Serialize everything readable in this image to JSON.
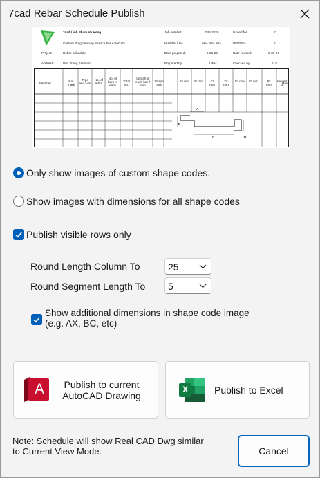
{
  "window": {
    "title": "7cad Rebar Schedule Publish"
  },
  "preview": {
    "company": "7cad Linh Pham Vu Hong",
    "service": "Custom Programming Service For AutoCAD",
    "project_label": "Project:",
    "project_value": "Rebar Schedule",
    "address_label": "Address:",
    "address_value": "Nha Trang, Vietnam",
    "job_number_label": "Job number:",
    "job_number_value": "045-2020",
    "issued_for_label": "Issued for:",
    "issued_for_value": "C",
    "drawing_info_label": "Drawing info:",
    "drawing_info_value": "510, 520, 521",
    "revision_label": "Revision:",
    "revision_value": "A",
    "date_prepared_label": "Date prepared:",
    "date_prepared_value": "9-26-24",
    "date_revised_label": "Date revised:",
    "date_revised_value": "8-30-24",
    "prepared_by_label": "Prepared by:",
    "prepared_by_value": "LINH",
    "checked_by_label": "Checked by:",
    "checked_by_value": "V.S",
    "columns": [
      "Member",
      "Bar mark",
      "Type and size",
      "No. of mbrs",
      "No. of bars in each",
      "Total no.",
      "Length of each bar † mm",
      "Shape code",
      "A* mm",
      "B* mm",
      "C* mm",
      "D* mm",
      "E* mm",
      "F* mm",
      "R* mm",
      "Weight kg",
      "Rev."
    ],
    "shape_labels": [
      "A",
      "B",
      "C",
      "D"
    ]
  },
  "options": {
    "radio_custom_label": "Only show images of custom shape codes.",
    "radio_custom_selected": true,
    "radio_all_label": "Show images with dimensions for all shape codes",
    "radio_all_selected": false,
    "publish_visible_label": "Publish visible rows only",
    "publish_visible_checked": true,
    "round_length_label": "Round Length Column To",
    "round_length_value": "25",
    "round_segment_label": "Round Segment Length To",
    "round_segment_value": "5",
    "show_additional_line1": "Show additional dimensions in shape code image",
    "show_additional_line2": "(e.g. AX, BC, etc)",
    "show_additional_checked": true
  },
  "actions": {
    "publish_autocad_line1": "Publish to current",
    "publish_autocad_line2": "AutoCAD Drawing",
    "autocad_icon_letter": "A",
    "publish_excel_label": "Publish to Excel",
    "excel_icon_letter": "X",
    "cancel_label": "Cancel"
  },
  "note": {
    "line1": "Note: Schedule will show Real CAD Dwg similar",
    "line2": "to Current View Mode."
  },
  "colors": {
    "accent": "#005fb8",
    "autocad_red": "#c8102e",
    "excel_green": "#107c41"
  }
}
